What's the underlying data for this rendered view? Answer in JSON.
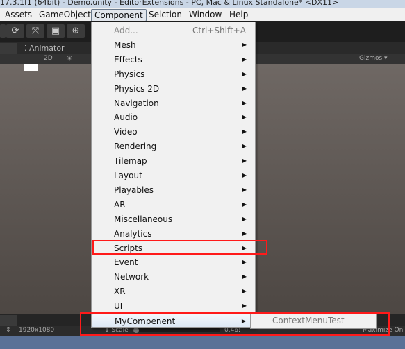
{
  "window": {
    "title": "17.3.1f1 (64bit) - Demo.unity - EditorExtensions - PC, Mac & Linux Standalone* <DX11>"
  },
  "menubar": [
    {
      "label": "Assets"
    },
    {
      "label": "GameObject"
    },
    {
      "label": "Component"
    },
    {
      "label": "Selction"
    },
    {
      "label": "Window"
    },
    {
      "label": "Help"
    }
  ],
  "tabs": {
    "animator": "Animator"
  },
  "scene_toolbar": {
    "mode_2d": "2D",
    "gizmos": "Gizmos"
  },
  "component_menu": [
    {
      "label": "Add...",
      "shortcut": "Ctrl+Shift+A",
      "disabled": true
    },
    {
      "label": "Mesh"
    },
    {
      "label": "Effects"
    },
    {
      "label": "Physics"
    },
    {
      "label": "Physics 2D"
    },
    {
      "label": "Navigation"
    },
    {
      "label": "Audio"
    },
    {
      "label": "Video"
    },
    {
      "label": "Rendering"
    },
    {
      "label": "Tilemap"
    },
    {
      "label": "Layout"
    },
    {
      "label": "Playables"
    },
    {
      "label": "AR"
    },
    {
      "label": "Miscellaneous"
    },
    {
      "label": "Analytics"
    },
    {
      "label": "Scripts"
    },
    {
      "label": "Event"
    },
    {
      "label": "Network"
    },
    {
      "label": "XR"
    },
    {
      "label": "UI"
    },
    {
      "label": "MyCompenent",
      "highlighted": true
    }
  ],
  "submenu": {
    "items": [
      "ContextMenuTest"
    ]
  },
  "game_toolbar": {
    "resolution": "1920x1080",
    "scale_label": "Scale",
    "scale_value": "0.46:",
    "maximize": "Maximize On"
  },
  "colors": {
    "highlight_box": "#ff1a1a"
  }
}
